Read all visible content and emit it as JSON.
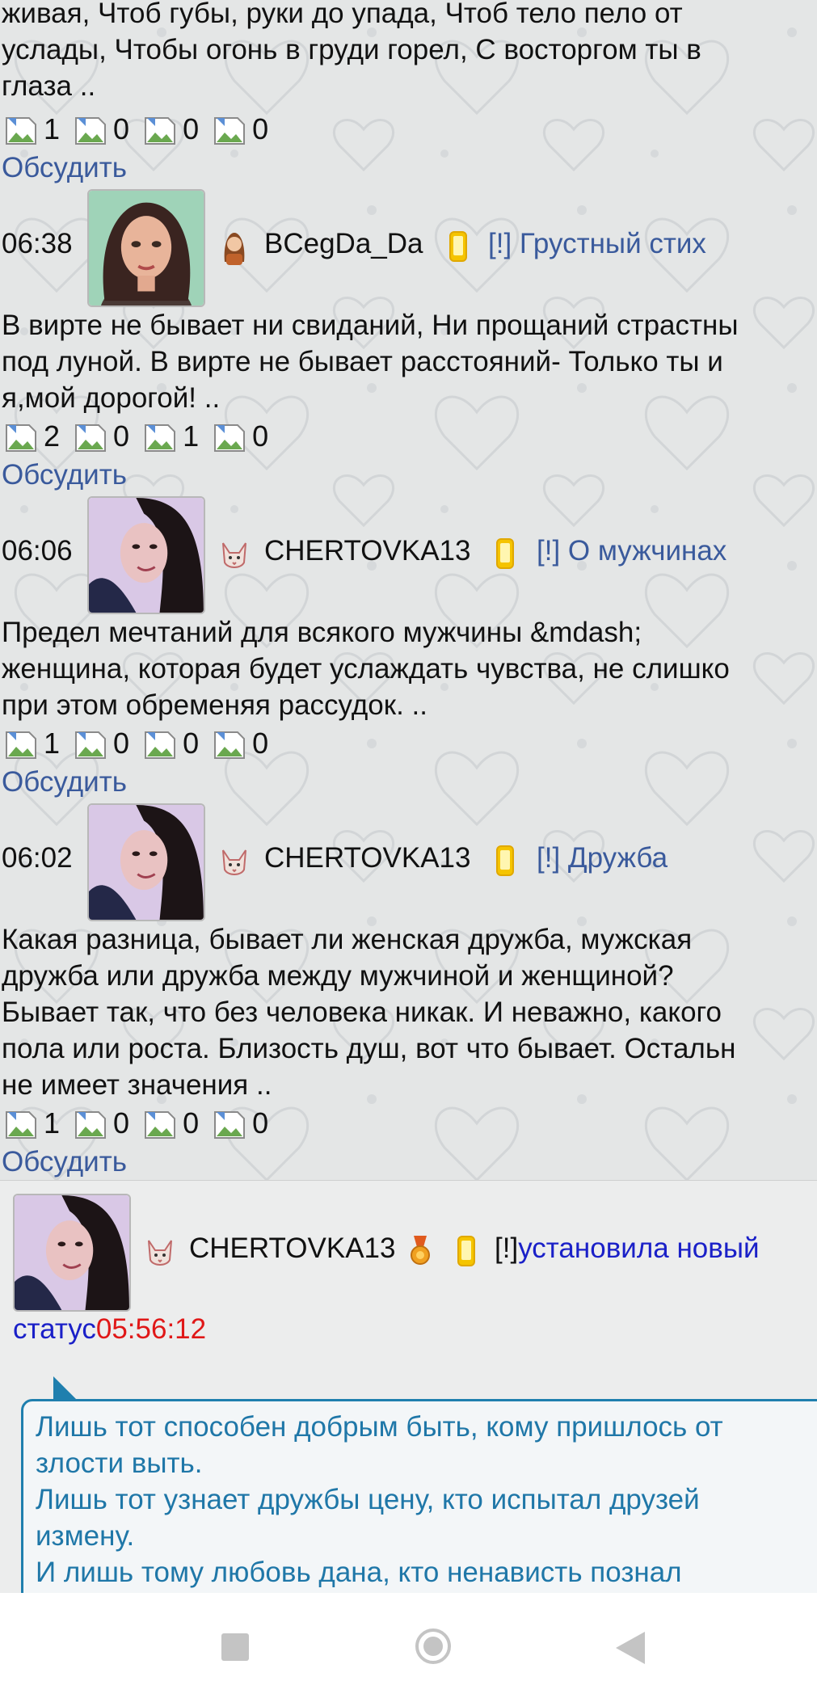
{
  "posts": [
    {
      "text_lines": [
        "живая, Чтоб губы, руки до упада, Чтоб тело пело от",
        "услады, Чтобы огонь в груди горел, С восторгом ты в",
        "глаза .."
      ],
      "counts": [
        "1",
        "0",
        "0",
        "0"
      ],
      "discuss": "Обсудить"
    },
    {
      "time": "06:38",
      "username": "BCegDa_Da",
      "topic": "[!] Грустный стих",
      "text_lines": [
        "В вирте не бывает ни свиданий, Ни прощаний страстны",
        "под луной. В вирте не бывает расстояний- Только ты и",
        "я,мой дорогой! .."
      ],
      "counts": [
        "2",
        "0",
        "1",
        "0"
      ],
      "discuss": "Обсудить"
    },
    {
      "time": "06:06",
      "username": "CHERTOVKA13",
      "topic": "[!] О мужчинах",
      "text_lines": [
        "Предел мечтаний для всякого мужчины &mdash;",
        "женщина, которая будет услаждать чувства, не слишко",
        "при этом обременяя рассудок. .."
      ],
      "counts": [
        "1",
        "0",
        "0",
        "0"
      ],
      "discuss": "Обсудить"
    },
    {
      "time": "06:02",
      "username": "CHERTOVKA13",
      "topic": "[!] Дружба",
      "text_lines": [
        "Какая разница, бывает ли женская дружба, мужская",
        "дружба или дружба между мужчиной и женщиной?",
        "Бывает так, что без человека никак. И неважно, какого",
        "пола или роста. Близость душ, вот что бывает. Остальн",
        "не имеет значения .."
      ],
      "counts": [
        "1",
        "0",
        "0",
        "0"
      ],
      "discuss": "Обсудить"
    }
  ],
  "status_update": {
    "username": "CHERTOVKA13",
    "prefix": "[!]",
    "action": "установила новый",
    "action_cont": "статус",
    "time": "05:56:12",
    "colors": {
      "action": "#1a20c8",
      "time": "#e01818"
    }
  },
  "status_quote": {
    "lines": [
      "Лишь тот способен добрым быть, кому пришлось от",
      "злости выть.",
      "Лишь тот узнает дружбы цену, кто испытал друзей",
      "измену.",
      "И лишь тому любовь дана, кто ненависть познал"
    ]
  },
  "colors": {
    "link": "#3a5a9c",
    "quote": "#1f77a8",
    "bubble_border": "#1f7fae"
  },
  "icons": {
    "count": "broken-image-icon",
    "user_female": "girl-avatar-icon",
    "user_cat": "cat-face-icon",
    "online": "phone-icon",
    "award": "medal-icon",
    "nav": [
      "square-recents-icon",
      "circle-home-icon",
      "triangle-back-icon"
    ]
  }
}
